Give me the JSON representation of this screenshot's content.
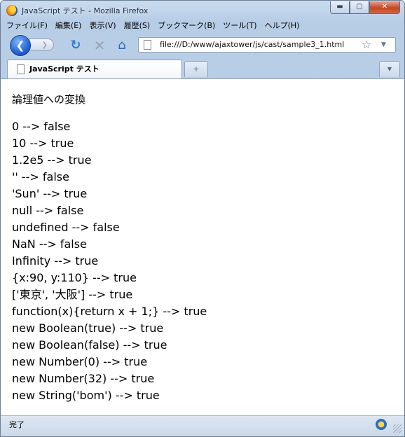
{
  "window": {
    "title": "JavaScript テスト - Mozilla Firefox",
    "controls": {
      "minimize": "▬",
      "maximize": "▢",
      "close": "✕"
    }
  },
  "menu": {
    "items": [
      {
        "label": "ファイル(F)"
      },
      {
        "label": "編集(E)"
      },
      {
        "label": "表示(V)"
      },
      {
        "label": "履歴(S)"
      },
      {
        "label": "ブックマーク(B)"
      },
      {
        "label": "ツール(T)"
      },
      {
        "label": "ヘルプ(H)"
      }
    ]
  },
  "navbar": {
    "back_glyph": "❮",
    "forward_glyph": "❯",
    "reload_glyph": "↻",
    "stop_glyph": "✕",
    "home_glyph": "⌂",
    "url": "file:///D:/www/ajaxtower/js/cast/sample3_1.html",
    "bookmark_glyph": "☆",
    "dropdown_glyph": "▼"
  },
  "tabs": {
    "active_label": "JavaScript テスト",
    "new_tab_glyph": "+",
    "list_glyph": "▼"
  },
  "page": {
    "heading": "論理値への変換",
    "results": [
      "0 --> false",
      "10 --> true",
      "1.2e5 --> true",
      "'' --> false",
      "'Sun' --> true",
      "null --> false",
      "undefined --> false",
      "NaN --> false",
      "Infinity --> true",
      "{x:90, y:110} --> true",
      "['東京', '大阪'] --> true",
      "function(x){return x + 1;} --> true",
      "new Boolean(true) --> true",
      "new Boolean(false) --> true",
      "new Number(0) --> true",
      "new Number(32) --> true",
      "new String('bom') --> true"
    ]
  },
  "status": {
    "text": "完了"
  }
}
